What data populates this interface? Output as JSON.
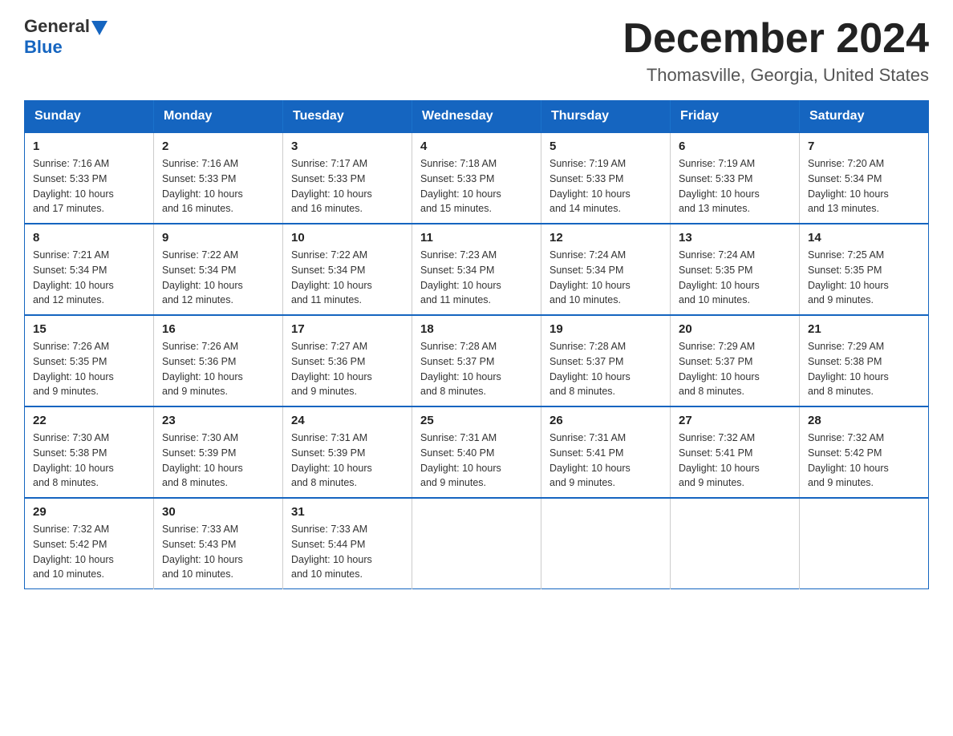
{
  "header": {
    "logo_general": "General",
    "logo_blue": "Blue",
    "title": "December 2024",
    "subtitle": "Thomasville, Georgia, United States"
  },
  "days_of_week": [
    "Sunday",
    "Monday",
    "Tuesday",
    "Wednesday",
    "Thursday",
    "Friday",
    "Saturday"
  ],
  "weeks": [
    [
      {
        "day": "1",
        "sunrise": "7:16 AM",
        "sunset": "5:33 PM",
        "daylight": "10 hours and 17 minutes."
      },
      {
        "day": "2",
        "sunrise": "7:16 AM",
        "sunset": "5:33 PM",
        "daylight": "10 hours and 16 minutes."
      },
      {
        "day": "3",
        "sunrise": "7:17 AM",
        "sunset": "5:33 PM",
        "daylight": "10 hours and 16 minutes."
      },
      {
        "day": "4",
        "sunrise": "7:18 AM",
        "sunset": "5:33 PM",
        "daylight": "10 hours and 15 minutes."
      },
      {
        "day": "5",
        "sunrise": "7:19 AM",
        "sunset": "5:33 PM",
        "daylight": "10 hours and 14 minutes."
      },
      {
        "day": "6",
        "sunrise": "7:19 AM",
        "sunset": "5:33 PM",
        "daylight": "10 hours and 13 minutes."
      },
      {
        "day": "7",
        "sunrise": "7:20 AM",
        "sunset": "5:34 PM",
        "daylight": "10 hours and 13 minutes."
      }
    ],
    [
      {
        "day": "8",
        "sunrise": "7:21 AM",
        "sunset": "5:34 PM",
        "daylight": "10 hours and 12 minutes."
      },
      {
        "day": "9",
        "sunrise": "7:22 AM",
        "sunset": "5:34 PM",
        "daylight": "10 hours and 12 minutes."
      },
      {
        "day": "10",
        "sunrise": "7:22 AM",
        "sunset": "5:34 PM",
        "daylight": "10 hours and 11 minutes."
      },
      {
        "day": "11",
        "sunrise": "7:23 AM",
        "sunset": "5:34 PM",
        "daylight": "10 hours and 11 minutes."
      },
      {
        "day": "12",
        "sunrise": "7:24 AM",
        "sunset": "5:34 PM",
        "daylight": "10 hours and 10 minutes."
      },
      {
        "day": "13",
        "sunrise": "7:24 AM",
        "sunset": "5:35 PM",
        "daylight": "10 hours and 10 minutes."
      },
      {
        "day": "14",
        "sunrise": "7:25 AM",
        "sunset": "5:35 PM",
        "daylight": "10 hours and 9 minutes."
      }
    ],
    [
      {
        "day": "15",
        "sunrise": "7:26 AM",
        "sunset": "5:35 PM",
        "daylight": "10 hours and 9 minutes."
      },
      {
        "day": "16",
        "sunrise": "7:26 AM",
        "sunset": "5:36 PM",
        "daylight": "10 hours and 9 minutes."
      },
      {
        "day": "17",
        "sunrise": "7:27 AM",
        "sunset": "5:36 PM",
        "daylight": "10 hours and 9 minutes."
      },
      {
        "day": "18",
        "sunrise": "7:28 AM",
        "sunset": "5:37 PM",
        "daylight": "10 hours and 8 minutes."
      },
      {
        "day": "19",
        "sunrise": "7:28 AM",
        "sunset": "5:37 PM",
        "daylight": "10 hours and 8 minutes."
      },
      {
        "day": "20",
        "sunrise": "7:29 AM",
        "sunset": "5:37 PM",
        "daylight": "10 hours and 8 minutes."
      },
      {
        "day": "21",
        "sunrise": "7:29 AM",
        "sunset": "5:38 PM",
        "daylight": "10 hours and 8 minutes."
      }
    ],
    [
      {
        "day": "22",
        "sunrise": "7:30 AM",
        "sunset": "5:38 PM",
        "daylight": "10 hours and 8 minutes."
      },
      {
        "day": "23",
        "sunrise": "7:30 AM",
        "sunset": "5:39 PM",
        "daylight": "10 hours and 8 minutes."
      },
      {
        "day": "24",
        "sunrise": "7:31 AM",
        "sunset": "5:39 PM",
        "daylight": "10 hours and 8 minutes."
      },
      {
        "day": "25",
        "sunrise": "7:31 AM",
        "sunset": "5:40 PM",
        "daylight": "10 hours and 9 minutes."
      },
      {
        "day": "26",
        "sunrise": "7:31 AM",
        "sunset": "5:41 PM",
        "daylight": "10 hours and 9 minutes."
      },
      {
        "day": "27",
        "sunrise": "7:32 AM",
        "sunset": "5:41 PM",
        "daylight": "10 hours and 9 minutes."
      },
      {
        "day": "28",
        "sunrise": "7:32 AM",
        "sunset": "5:42 PM",
        "daylight": "10 hours and 9 minutes."
      }
    ],
    [
      {
        "day": "29",
        "sunrise": "7:32 AM",
        "sunset": "5:42 PM",
        "daylight": "10 hours and 10 minutes."
      },
      {
        "day": "30",
        "sunrise": "7:33 AM",
        "sunset": "5:43 PM",
        "daylight": "10 hours and 10 minutes."
      },
      {
        "day": "31",
        "sunrise": "7:33 AM",
        "sunset": "5:44 PM",
        "daylight": "10 hours and 10 minutes."
      },
      null,
      null,
      null,
      null
    ]
  ],
  "labels": {
    "sunrise": "Sunrise:",
    "sunset": "Sunset:",
    "daylight": "Daylight:"
  }
}
